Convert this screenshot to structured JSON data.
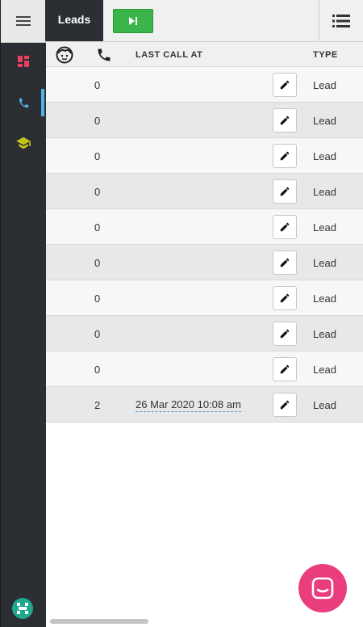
{
  "header": {
    "tab_label": "Leads",
    "play_icon": "skip-next-icon",
    "list_icon": "list-icon",
    "menu_icon": "hamburger-icon"
  },
  "sidebar": {
    "items": [
      {
        "icon": "dashboard-icon",
        "color": "#e8405f"
      },
      {
        "icon": "phone-icon",
        "color": "#4fb3ea",
        "active": true
      },
      {
        "icon": "graduation-cap-icon",
        "color": "#c6c21c"
      }
    ],
    "logo_icon": "robot-logo-icon"
  },
  "table": {
    "headers": {
      "contact_icon": "face-icon",
      "calls_icon": "phone-icon",
      "last_call": "LAST CALL AT",
      "type": "TYPE"
    },
    "rows": [
      {
        "calls": "0",
        "last_call": "",
        "type": "Lead"
      },
      {
        "calls": "0",
        "last_call": "",
        "type": "Lead"
      },
      {
        "calls": "0",
        "last_call": "",
        "type": "Lead"
      },
      {
        "calls": "0",
        "last_call": "",
        "type": "Lead"
      },
      {
        "calls": "0",
        "last_call": "",
        "type": "Lead"
      },
      {
        "calls": "0",
        "last_call": "",
        "type": "Lead"
      },
      {
        "calls": "0",
        "last_call": "",
        "type": "Lead"
      },
      {
        "calls": "0",
        "last_call": "",
        "type": "Lead"
      },
      {
        "calls": "0",
        "last_call": "",
        "type": "Lead"
      },
      {
        "calls": "2",
        "last_call": "26 Mar 2020 10:08 am",
        "type": "Lead"
      }
    ]
  },
  "chat": {
    "icon": "chat-bubble-icon",
    "color": "#ea3d7d"
  }
}
